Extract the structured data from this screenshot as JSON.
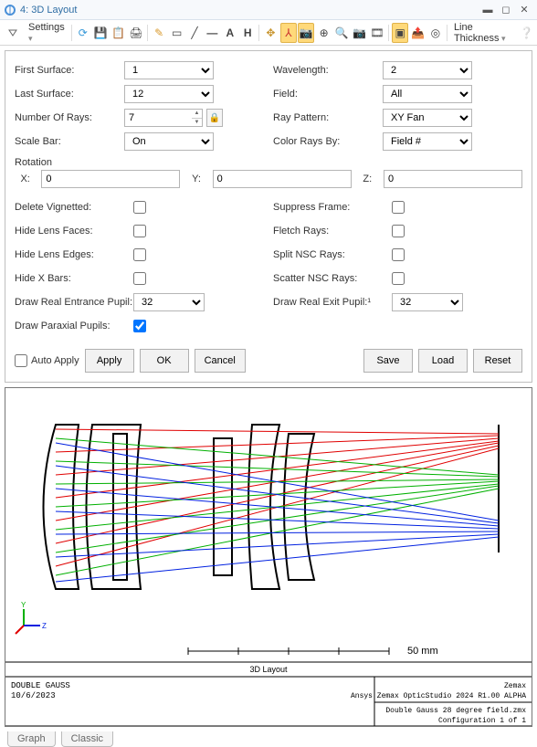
{
  "window": {
    "title": "4: 3D Layout"
  },
  "toolbar": {
    "settings_label": "Settings",
    "line_thickness_label": "Line Thickness"
  },
  "settings": {
    "first_surface_label": "First Surface:",
    "first_surface_value": "1",
    "last_surface_label": "Last Surface:",
    "last_surface_value": "12",
    "number_of_rays_label": "Number Of Rays:",
    "number_of_rays_value": "7",
    "scale_bar_label": "Scale Bar:",
    "scale_bar_value": "On",
    "wavelength_label": "Wavelength:",
    "wavelength_value": "2",
    "field_label": "Field:",
    "field_value": "All",
    "ray_pattern_label": "Ray Pattern:",
    "ray_pattern_value": "XY Fan",
    "color_rays_by_label": "Color Rays By:",
    "color_rays_by_value": "Field #",
    "rotation_label": "Rotation",
    "rot_x_label": "X:",
    "rot_x_value": "0",
    "rot_y_label": "Y:",
    "rot_y_value": "0",
    "rot_z_label": "Z:",
    "rot_z_value": "0",
    "delete_vignetted_label": "Delete Vignetted:",
    "hide_lens_faces_label": "Hide Lens Faces:",
    "hide_lens_edges_label": "Hide Lens Edges:",
    "hide_x_bars_label": "Hide X Bars:",
    "draw_real_entrance_label": "Draw Real Entrance Pupil:",
    "draw_real_entrance_value": "32",
    "draw_paraxial_label": "Draw Paraxial Pupils:",
    "suppress_frame_label": "Suppress Frame:",
    "fletch_rays_label": "Fletch Rays:",
    "split_nsc_label": "Split NSC Rays:",
    "scatter_nsc_label": "Scatter NSC Rays:",
    "draw_real_exit_label": "Draw Real Exit Pupil:¹",
    "draw_real_exit_value": "32"
  },
  "buttons": {
    "auto_apply": "Auto Apply",
    "apply": "Apply",
    "ok": "OK",
    "cancel": "Cancel",
    "save": "Save",
    "load": "Load",
    "reset": "Reset"
  },
  "plot": {
    "scale_label": "50 mm",
    "caption": "3D Layout",
    "info_left_line1": "DOUBLE GAUSS",
    "info_left_line2": "10/6/2023",
    "info_right_line1": "Zemax",
    "info_right_line2": "Ansys Zemax OpticStudio 2024 R1.00 ALPHA",
    "info_right_line3": "Double Gauss 28 degree field.zmx",
    "info_right_line4": "Configuration 1 of 1"
  },
  "tabs": {
    "graph": "Graph",
    "classic": "Classic"
  },
  "chart_data": {
    "type": "other",
    "title": "3D Layout",
    "system": "DOUBLE GAUSS",
    "date": "10/6/2023",
    "software": "Ansys Zemax OpticStudio 2024 R1.00 ALPHA",
    "file": "Double Gauss 28 degree field.zmx",
    "configuration": "1 of 1",
    "scale_bar_mm": 50,
    "axes": [
      "Y",
      "Z"
    ],
    "fields_colors": [
      "#e00000",
      "#00b000",
      "#0020e0"
    ],
    "rays_per_field": 7,
    "lens_elements_drawn": 6
  }
}
